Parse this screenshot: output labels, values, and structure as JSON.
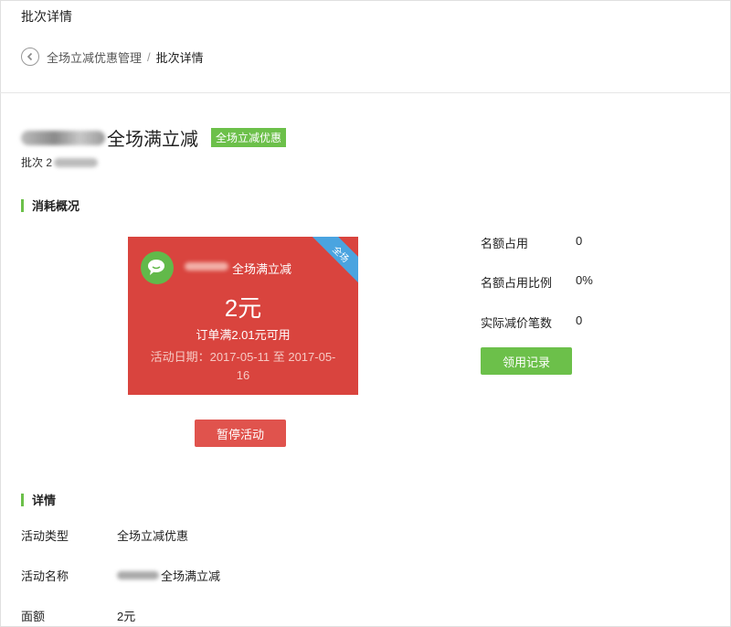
{
  "page": {
    "title": "批次详情"
  },
  "breadcrumb": {
    "parent": "全场立减优惠管理",
    "separator": "/",
    "current": "批次详情"
  },
  "batch": {
    "name_suffix": "全场满立减",
    "badge": "全场立减优惠",
    "number_label": "批次 2"
  },
  "consumption": {
    "heading": "消耗概况",
    "coupon": {
      "name": "全场满立减",
      "ribbon": "全场",
      "amount": "2元",
      "condition": "订单满2.01元可用",
      "date_line1": "活动日期：2017-05-11 至 2017-05-",
      "date_line2": "16"
    },
    "pause_button": "暂停活动",
    "stats": [
      {
        "label": "名额占用",
        "value": "0"
      },
      {
        "label": "名额占用比例",
        "value": "0%"
      },
      {
        "label": "实际减价笔数",
        "value": "0"
      }
    ],
    "records_button": "领用记录"
  },
  "details": {
    "heading": "详情",
    "rows": [
      {
        "label": "活动类型",
        "value": "全场立减优惠"
      },
      {
        "label": "活动名称",
        "value": "全场满立减"
      },
      {
        "label": "面额",
        "value": "2元"
      }
    ]
  },
  "colors": {
    "accent_green": "#6cc04a",
    "coupon_red": "#d9443e",
    "ribbon_blue": "#4aa4e0",
    "pause_red": "#e0534d"
  },
  "icons": {
    "back": "chevron-left-icon",
    "wechat": "wechat-logo-icon"
  }
}
